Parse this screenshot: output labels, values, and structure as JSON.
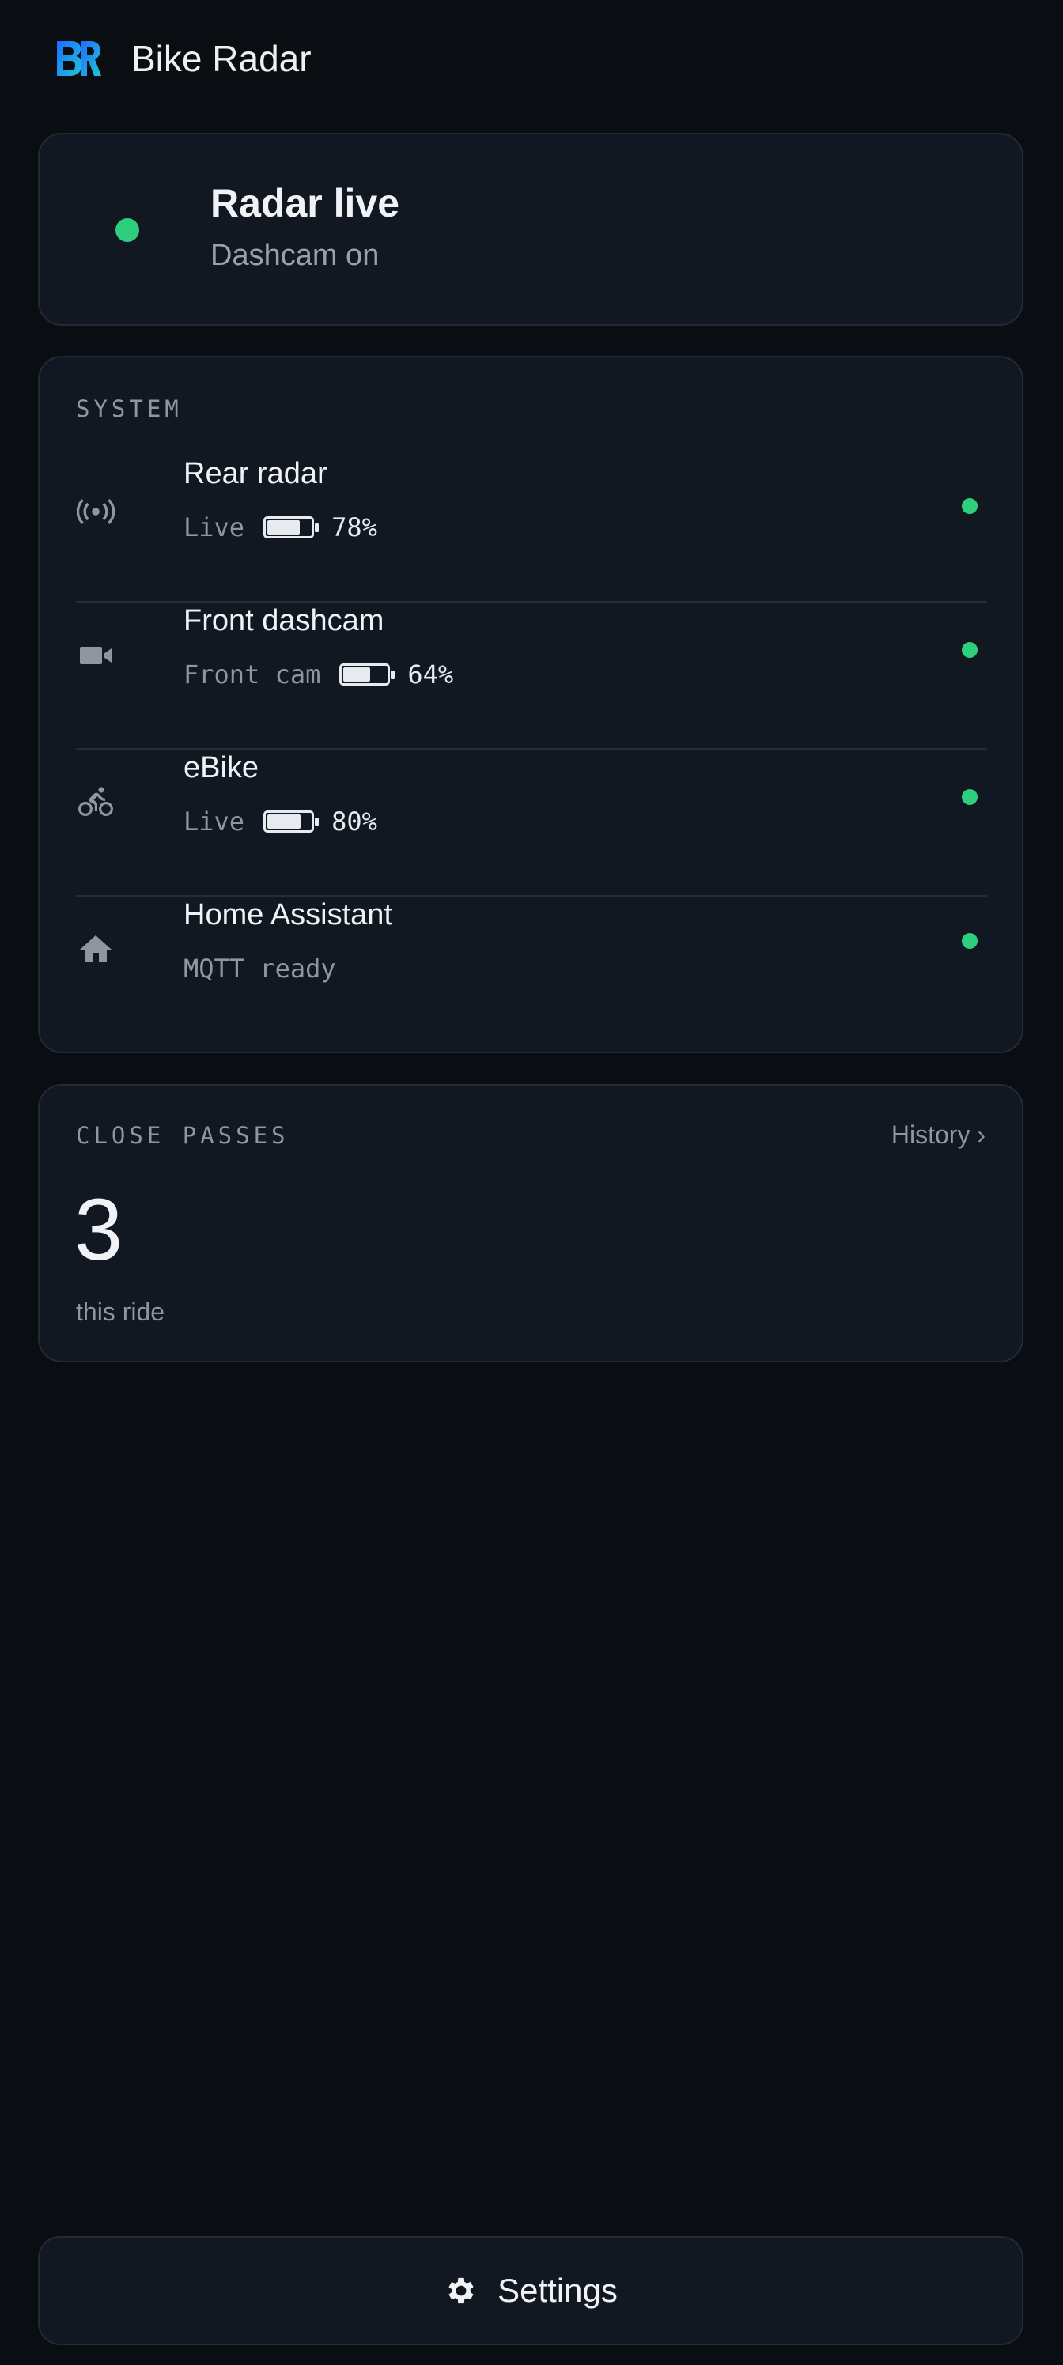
{
  "app": {
    "title": "Bike Radar",
    "logo_icon": "br-logo-icon",
    "colors": {
      "background": "#0a0d12",
      "card": "#111821",
      "ok": "#2ecf7c",
      "muted": "#8e96a2",
      "logo_start": "#1e6cff",
      "logo_end": "#1fc6d6"
    }
  },
  "status": {
    "title": "Radar live",
    "subtitle": "Dashcam on",
    "indicator": "ok"
  },
  "system": {
    "label": "SYSTEM",
    "items": [
      {
        "title": "Rear radar",
        "meta": "Live",
        "battery_percent": 78,
        "battery_label": "78%",
        "icon": "radar-icon",
        "status": "ok"
      },
      {
        "title": "Front dashcam",
        "meta": "Front cam",
        "battery_percent": 64,
        "battery_label": "64%",
        "icon": "camera-icon",
        "status": "ok"
      },
      {
        "title": "eBike",
        "meta": "Live",
        "battery_percent": 80,
        "battery_label": "80%",
        "icon": "bicycle-icon",
        "status": "ok"
      },
      {
        "title": "Home Assistant",
        "meta": "MQTT ready",
        "icon": "home-icon",
        "status": "ok"
      }
    ]
  },
  "close_passes": {
    "label": "CLOSE PASSES",
    "history_link": "History ›",
    "count": "3",
    "caption": "this ride"
  },
  "settings": {
    "label": "Settings",
    "icon": "gear-icon"
  }
}
